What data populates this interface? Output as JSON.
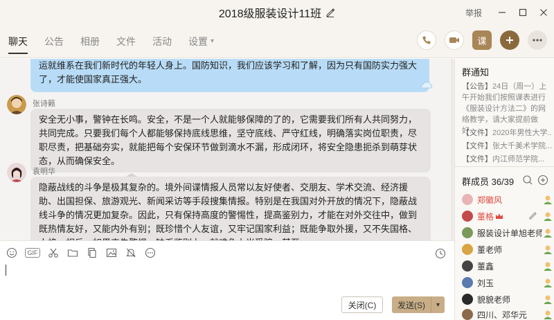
{
  "window": {
    "title": "2018级服装设计11班",
    "report": "举报"
  },
  "tabs": [
    {
      "label": "聊天"
    },
    {
      "label": "公告"
    },
    {
      "label": "相册"
    },
    {
      "label": "文件"
    },
    {
      "label": "活动"
    },
    {
      "label": "设置"
    }
  ],
  "actions": {
    "course_label": "课"
  },
  "messages": [
    {
      "sender": "",
      "text": "运就维系在我们新时代的年轻人身上。国防知识，我们应该学习和了解，因为只有国防实力强大了，才能使国家真正强大。"
    },
    {
      "sender": "张诗籁",
      "text": "安全无小事，警钟在长鸣。安全，不是一个人就能够保障的了的，它需要我们所有人共同努力，共同完成。只要我们每个人都能够保持底线思维，坚守底线、严守红线，明确落实岗位职责，尽职尽责，把基础夯实，就能把每个安保环节做到滴水不漏，形成闭环，将安全隐患扼杀到萌芽状态，从而确保安全。"
    },
    {
      "sender": "袁明华",
      "text": "隐蔽战线的斗争是极其复杂的。境外间谍情报人员常以友好使者、交朋友、学术交流、经济援助、出国担保、旅游观光、新闻采访等手段搜集情报。特别是在我国对外开放的情况下，隐蔽战线斗争的情况更加复杂。因此，只有保持高度的警惕性，提高鉴别力，才能在对外交往中，做到既热情友好，又能内外有别；既珍惜个人友谊，又牢记国家利益；既能争取外援，又不失国格、人格。相反，如果丧失警惕，缺乏鉴别力，就难免上当受骗，甚至"
    }
  ],
  "input": {
    "close_label": "关闭(C)",
    "send_label": "发送(S)"
  },
  "notice": {
    "title": "群通知",
    "announce_tag": "【公告】",
    "announce_text": "24日（周一）上午开始我们按照课表进行《服装设计方法二》的网络教学，请大家提前做好...",
    "files": [
      {
        "tag": "【文件】",
        "text": "2020年男性大学..."
      },
      {
        "tag": "【文件】",
        "text": "张大千美术学院..."
      },
      {
        "tag": "【文件】",
        "text": "内江师范学院..."
      }
    ]
  },
  "members": {
    "header": "群成员 36/39",
    "list": [
      {
        "name": "郑徽风",
        "color": "red",
        "avatar_color": "#e8b4b4"
      },
      {
        "name": "董格",
        "color": "red",
        "avatar_color": "#c44a4a",
        "crown": true
      },
      {
        "name": "服装设计单旭老师",
        "color": "normal",
        "avatar_color": "#7a9a5a"
      },
      {
        "name": "董老师",
        "color": "normal",
        "avatar_color": "#d9a441"
      },
      {
        "name": "董鑫",
        "color": "normal",
        "avatar_color": "#444444"
      },
      {
        "name": "刘玉",
        "color": "normal",
        "avatar_color": "#5a7ab0"
      },
      {
        "name": "貌貌老师",
        "color": "normal",
        "avatar_color": "#2a2a2a"
      },
      {
        "name": "四川、邓华元",
        "color": "normal",
        "avatar_color": "#8a6a4a"
      }
    ]
  }
}
